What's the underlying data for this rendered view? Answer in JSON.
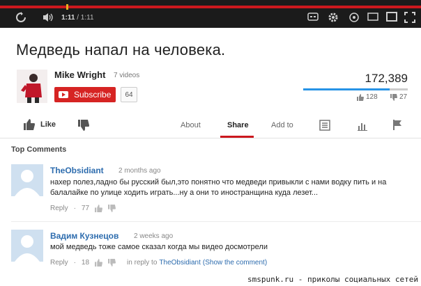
{
  "player": {
    "time_current": "1:11",
    "time_duration": "/ 1:11",
    "progress": 1.0
  },
  "video": {
    "title": "Медведь напал на человека.",
    "views": "172,389",
    "likes": "128",
    "dislikes": "27",
    "like_fraction": 0.826
  },
  "channel": {
    "name": "Mike Wright",
    "video_count": "7 videos",
    "subscribe_label": "Subscribe",
    "subscriber_count": "64"
  },
  "actions": {
    "like_label": "Like",
    "tabs": [
      "About",
      "Share",
      "Add to"
    ],
    "active_tab": "Share"
  },
  "comments": {
    "heading": "Top Comments",
    "items": [
      {
        "author": "TheObsidiant",
        "time": "2 months ago",
        "text": "нахер полез,ладно бы русский был,это понятно что медведи привыкли с нами водку пить и на балалайке по улице ходить играть...ну а они то иностранщина куда лезет...",
        "reply_label": "Reply",
        "likes": "77"
      },
      {
        "author": "Вадим Кузнецов",
        "time": "2 weeks ago",
        "text": "мой медведь тоже самое сказал когда мы видео досмотрели",
        "reply_label": "Reply",
        "likes": "18",
        "in_reply_prefix": "in reply to",
        "in_reply_to": "TheObsidiant",
        "show_comment": "(Show the comment)"
      }
    ]
  },
  "watermark": "smspunk.ru - приколы социальных сетей",
  "colors": {
    "accent_red": "#cc181e",
    "link_blue": "#2d6cae",
    "like_bar": "#2793e6"
  }
}
